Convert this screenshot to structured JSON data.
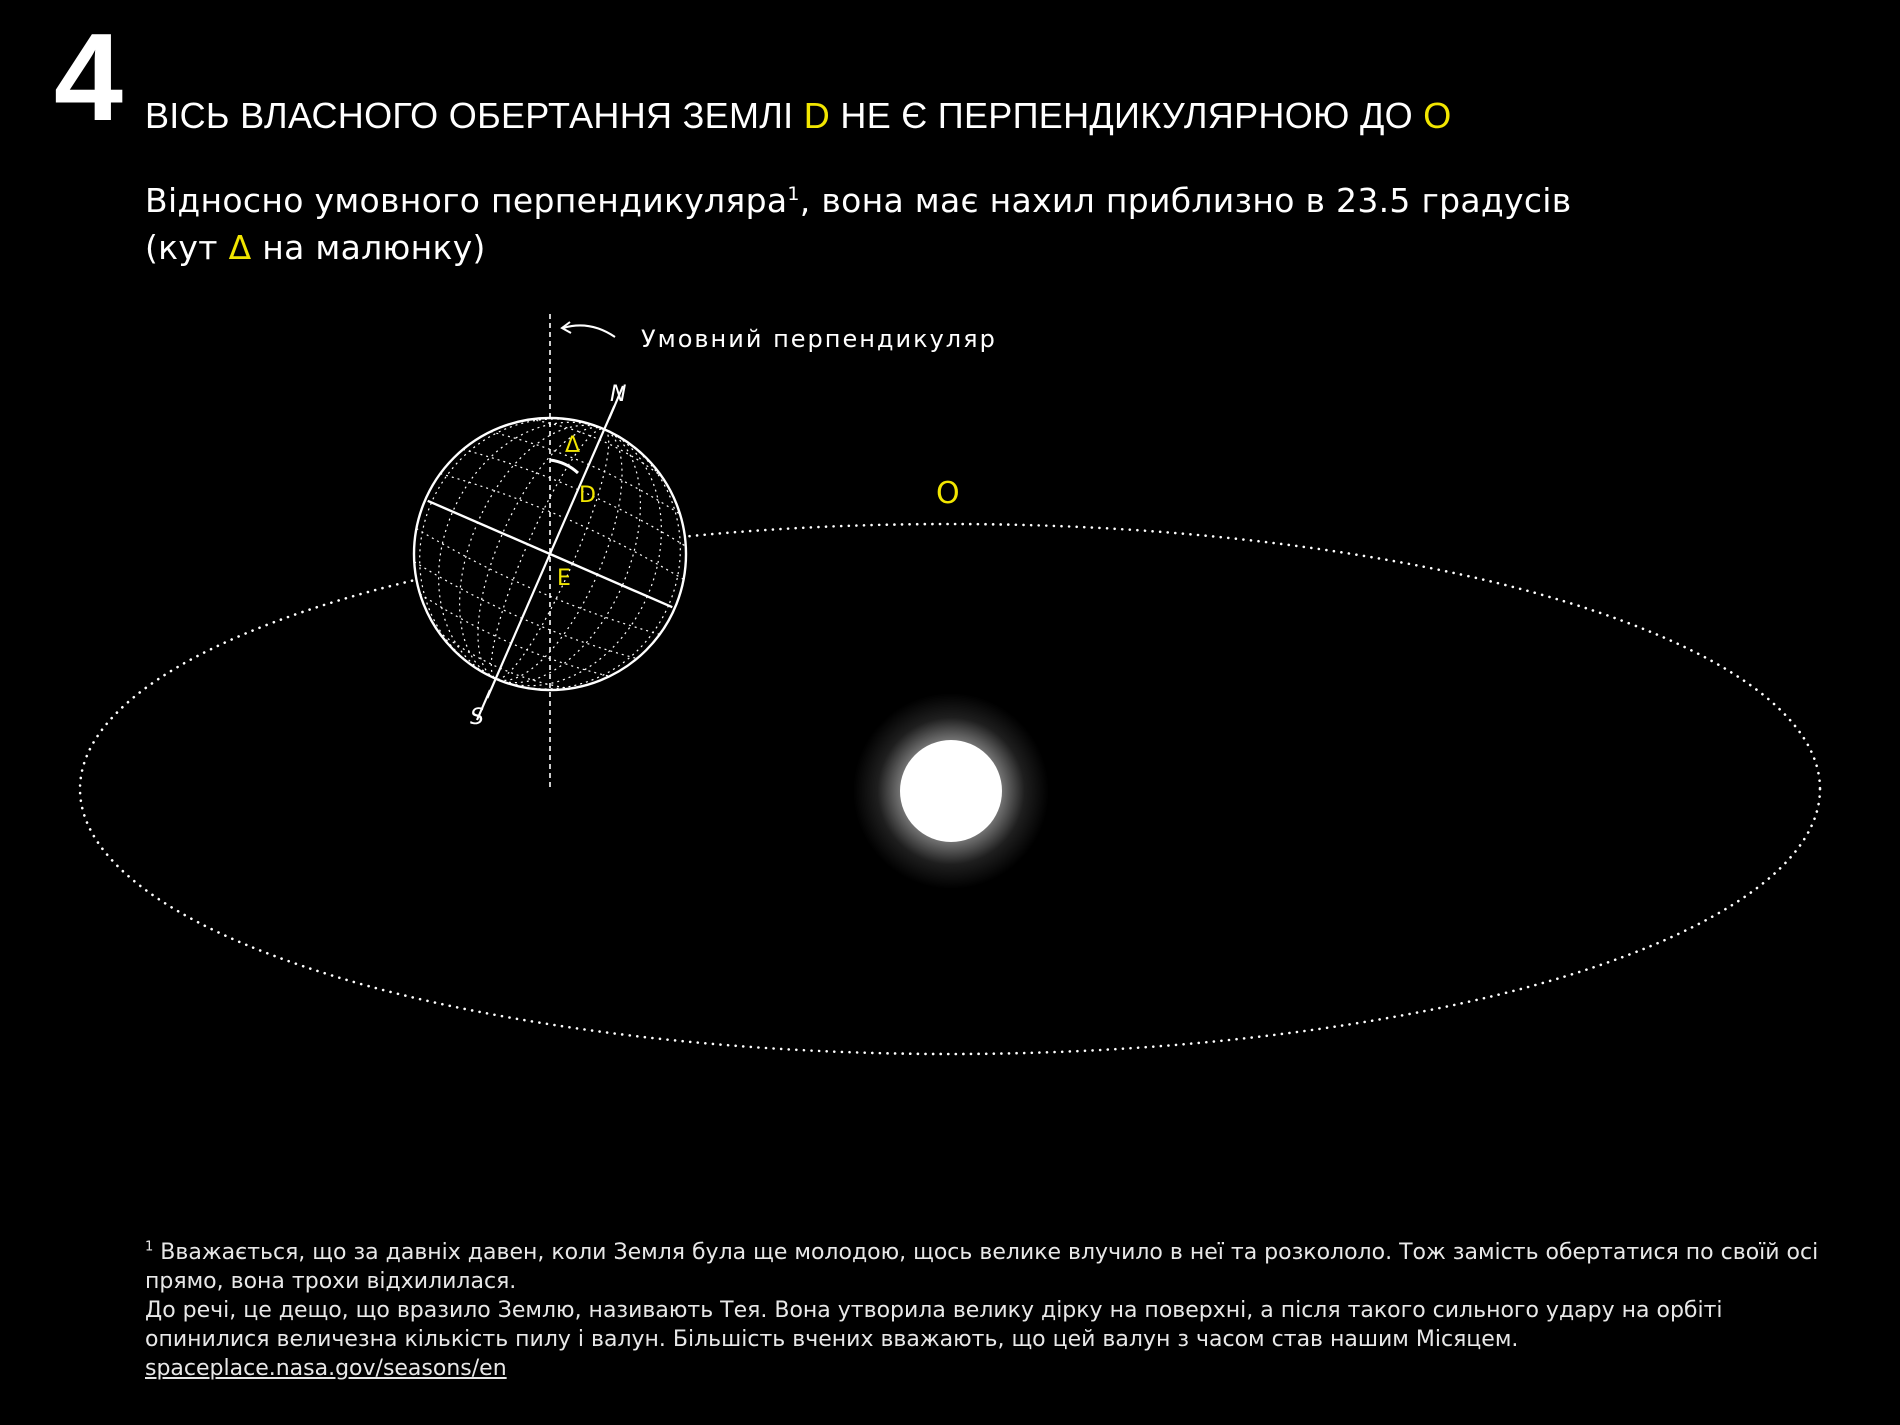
{
  "step_number": "4",
  "heading": {
    "part1": "ВІСЬ ВЛАСНОГО ОБЕРТАННЯ ЗЕМЛІ ",
    "axis_letter": "D",
    "part2": " НЕ Є ПЕРПЕНДИКУЛЯРНОЮ ДО ",
    "orbit_letter": "O"
  },
  "subtitle": {
    "part1": "Відносно умовного перпендикуляра",
    "footnote_mark": "1",
    "part2": ", вона має нахил приблизно в 23.5 градусів",
    "part3": "(кут ",
    "angle_symbol": "Δ",
    "part4": " на малюнку)"
  },
  "diagram": {
    "perpendicular_label": "Умовний перпендикуляр",
    "north_label": "N",
    "south_label": "S",
    "angle_label": "Δ",
    "axis_label": "D",
    "equator_label": "E",
    "orbit_label": "O",
    "tilt_degrees": 23.5,
    "highlight_color": "#f2e600",
    "line_color": "#ffffff",
    "background_color": "#000000"
  },
  "footnote": {
    "mark": "1",
    "line1": " Вважається, що за давніх давен, коли Земля була ще молодою, щось велике влучило в неї та розкололо. Тож замість обертатися по своїй осі прямо, вона трохи відхилилася.",
    "line2": "До речі, це дещо, що вразило Землю, називають Тея. Вона утворила велику дірку на поверхні, а після такого сильного удару на орбіті опинилися величезна кількість пилу і валун. Більшість вчених вважають, що цей валун з часом став нашим Місяцем.",
    "link_text": "spaceplace.nasa.gov/seasons/en"
  }
}
